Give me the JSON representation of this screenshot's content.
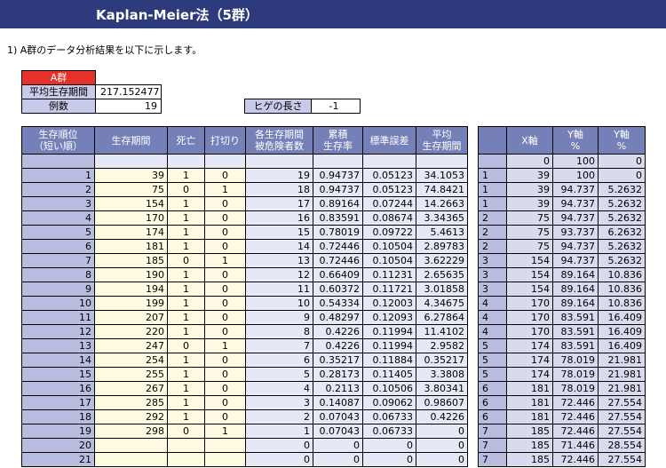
{
  "title": "Kaplan-Meier法（5群）",
  "intro": "1)  A群のデータ分析結果を以下に示します。",
  "summary": {
    "group_label": "A群",
    "mean_label": "平均生存期間",
    "mean_value": "217.152477",
    "count_label": "例数",
    "count_value": "19",
    "whisker_label": "ヒゲの長さ",
    "whisker_value": "-1"
  },
  "left_headers": [
    "生存順位\n（短い順）",
    "生存期間",
    "死亡",
    "打切り",
    "各生存期間\n被危険者数",
    "累積\n生存率",
    "標準誤差",
    "平均\n生存期間"
  ],
  "right_headers": [
    "",
    "X軸",
    "Y軸\n%",
    "Y軸\n%"
  ],
  "left_rows": [
    [
      "",
      "",
      "",
      "",
      "",
      "",
      "",
      ""
    ],
    [
      "1",
      "39",
      "1",
      "0",
      "19",
      "0.94737",
      "0.05123",
      "34.1053"
    ],
    [
      "2",
      "75",
      "0",
      "1",
      "18",
      "0.94737",
      "0.05123",
      "74.8421"
    ],
    [
      "3",
      "154",
      "1",
      "0",
      "17",
      "0.89164",
      "0.07244",
      "14.2663"
    ],
    [
      "4",
      "170",
      "1",
      "0",
      "16",
      "0.83591",
      "0.08674",
      "3.34365"
    ],
    [
      "5",
      "174",
      "1",
      "0",
      "15",
      "0.78019",
      "0.09722",
      "5.4613"
    ],
    [
      "6",
      "181",
      "1",
      "0",
      "14",
      "0.72446",
      "0.10504",
      "2.89783"
    ],
    [
      "7",
      "185",
      "0",
      "1",
      "13",
      "0.72446",
      "0.10504",
      "3.62229"
    ],
    [
      "8",
      "190",
      "1",
      "0",
      "12",
      "0.66409",
      "0.11231",
      "2.65635"
    ],
    [
      "9",
      "194",
      "1",
      "0",
      "11",
      "0.60372",
      "0.11721",
      "3.01858"
    ],
    [
      "10",
      "199",
      "1",
      "0",
      "10",
      "0.54334",
      "0.12003",
      "4.34675"
    ],
    [
      "11",
      "207",
      "1",
      "0",
      "9",
      "0.48297",
      "0.12093",
      "6.27864"
    ],
    [
      "12",
      "220",
      "1",
      "0",
      "8",
      "0.4226",
      "0.11994",
      "11.4102"
    ],
    [
      "13",
      "247",
      "0",
      "1",
      "7",
      "0.4226",
      "0.11994",
      "2.9582"
    ],
    [
      "14",
      "254",
      "1",
      "0",
      "6",
      "0.35217",
      "0.11884",
      "0.35217"
    ],
    [
      "15",
      "255",
      "1",
      "0",
      "5",
      "0.28173",
      "0.11405",
      "3.3808"
    ],
    [
      "16",
      "267",
      "1",
      "0",
      "4",
      "0.2113",
      "0.10506",
      "3.80341"
    ],
    [
      "17",
      "285",
      "1",
      "0",
      "3",
      "0.14087",
      "0.09062",
      "0.98607"
    ],
    [
      "18",
      "292",
      "1",
      "0",
      "2",
      "0.07043",
      "0.06733",
      "0.4226"
    ],
    [
      "19",
      "298",
      "0",
      "1",
      "1",
      "0.07043",
      "0.06733",
      "0"
    ],
    [
      "20",
      "",
      "",
      "",
      "0",
      "0",
      "0",
      "0"
    ],
    [
      "21",
      "",
      "",
      "",
      "0",
      "0",
      "0",
      "0"
    ]
  ],
  "right_rows": [
    [
      "",
      "0",
      "100",
      "0"
    ],
    [
      "1",
      "39",
      "100",
      "0"
    ],
    [
      "1",
      "39",
      "94.737",
      "5.2632"
    ],
    [
      "1",
      "39",
      "94.737",
      "5.2632"
    ],
    [
      "2",
      "75",
      "94.737",
      "5.2632"
    ],
    [
      "2",
      "75",
      "93.737",
      "6.2632"
    ],
    [
      "2",
      "75",
      "94.737",
      "5.2632"
    ],
    [
      "3",
      "154",
      "94.737",
      "5.2632"
    ],
    [
      "3",
      "154",
      "89.164",
      "10.836"
    ],
    [
      "3",
      "154",
      "89.164",
      "10.836"
    ],
    [
      "4",
      "170",
      "89.164",
      "10.836"
    ],
    [
      "4",
      "170",
      "83.591",
      "16.409"
    ],
    [
      "4",
      "170",
      "83.591",
      "16.409"
    ],
    [
      "5",
      "174",
      "83.591",
      "16.409"
    ],
    [
      "5",
      "174",
      "78.019",
      "21.981"
    ],
    [
      "5",
      "174",
      "78.019",
      "21.981"
    ],
    [
      "6",
      "181",
      "78.019",
      "21.981"
    ],
    [
      "6",
      "181",
      "72.446",
      "27.554"
    ],
    [
      "6",
      "181",
      "72.446",
      "27.554"
    ],
    [
      "7",
      "185",
      "72.446",
      "27.554"
    ],
    [
      "7",
      "185",
      "71.446",
      "28.554"
    ],
    [
      "7",
      "185",
      "72.446",
      "27.554"
    ]
  ]
}
